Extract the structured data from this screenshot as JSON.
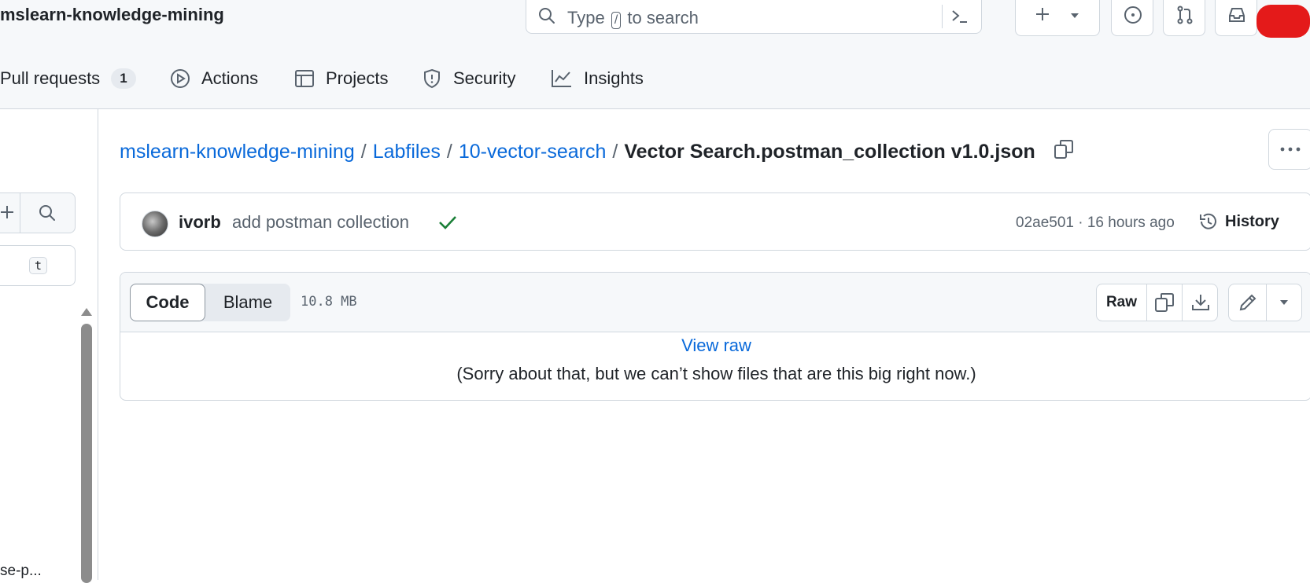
{
  "header": {
    "repo_title": "mslearn-knowledge-mining",
    "search": {
      "prefix": "Type",
      "key": "/",
      "suffix": "to search"
    },
    "icons": [
      "search-icon",
      "command-palette-icon",
      "plus-icon",
      "triangle-down-icon",
      "issue-opened-icon",
      "git-pull-request-icon",
      "inbox-icon"
    ]
  },
  "nav": {
    "pulls": {
      "label": "Pull requests",
      "count": "1"
    },
    "actions": {
      "label": "Actions"
    },
    "projects": {
      "label": "Projects"
    },
    "security": {
      "label": "Security"
    },
    "insights": {
      "label": "Insights"
    }
  },
  "sidebar": {
    "filter_key": "t",
    "truncated_item": "se-p..."
  },
  "breadcrumb": {
    "repo": "mslearn-knowledge-mining",
    "dir1": "Labfiles",
    "dir2": "10-vector-search",
    "file": "Vector Search.postman_collection v1.0.json",
    "sep": "/"
  },
  "commit": {
    "author": "ivorb",
    "message": "add postman collection",
    "meta": "02ae501 · 16 hours ago",
    "history_label": "History",
    "status_color": "#1a7f37"
  },
  "file": {
    "tabs": {
      "code": "Code",
      "blame": "Blame"
    },
    "size": "10.8 MB",
    "raw_label": "Raw",
    "view_raw": "View raw",
    "too_big_message": "(Sorry about that, but we can’t show files that are this big right now.)"
  },
  "colors": {
    "link": "#0969da",
    "border": "#d0d7de",
    "muted": "#59636e",
    "redaction": "#e41a1a"
  }
}
